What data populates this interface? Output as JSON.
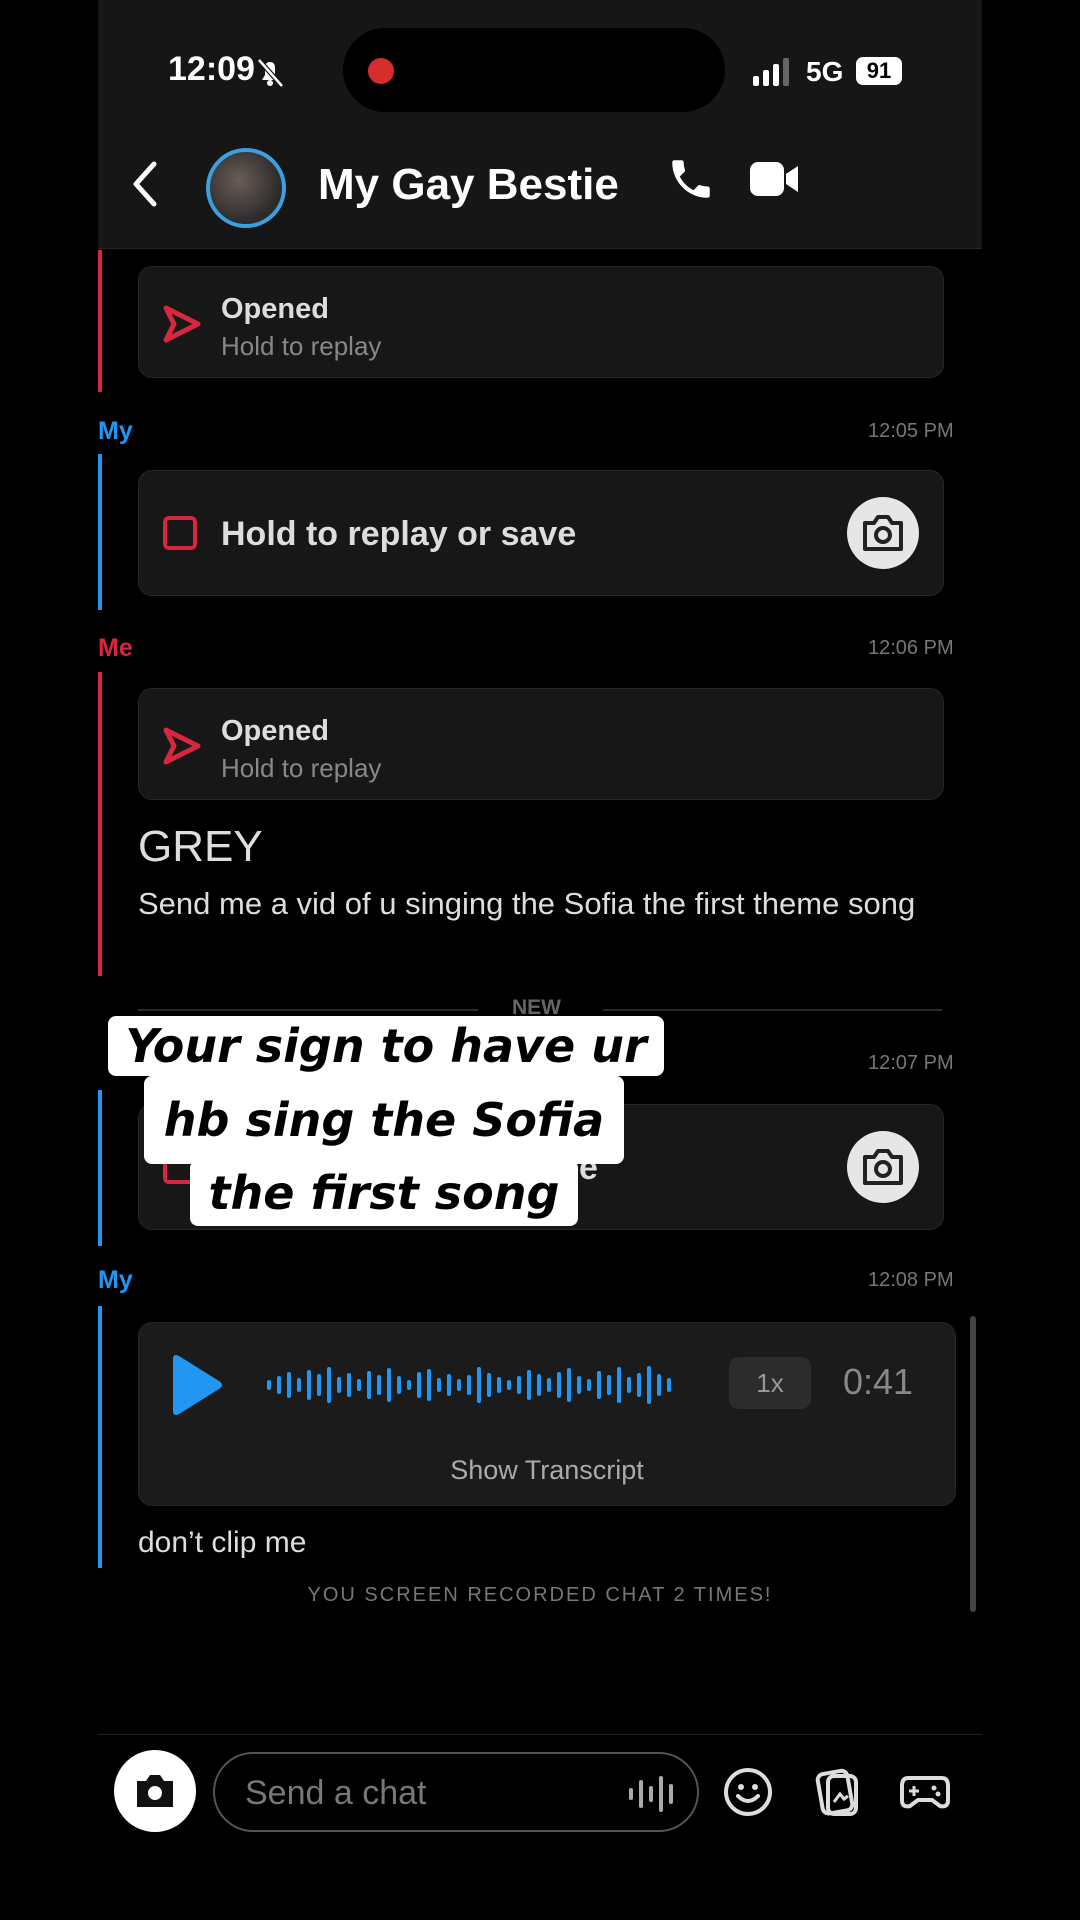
{
  "status_bar": {
    "time": "12:09",
    "network": "5G",
    "battery": "91"
  },
  "header": {
    "chat_name": "My Gay Bestie"
  },
  "messages": {
    "opened1": {
      "label": "Opened",
      "sub": "Hold to replay"
    },
    "my1": {
      "sender": "My",
      "time": "12:05 PM",
      "text": "Hold to replay or save"
    },
    "me1": {
      "sender": "Me",
      "time": "12:06 PM"
    },
    "opened2": {
      "label": "Opened",
      "sub": "Hold to replay"
    },
    "grey": "GREY",
    "msg_text": "Send me a vid of u singing the Sofia the first theme song",
    "new_label": "NEW",
    "snap2": {
      "time": "12:07 PM",
      "text_tail": "e"
    },
    "my2": {
      "sender": "My",
      "time": "12:08 PM"
    },
    "voice": {
      "speed": "1x",
      "duration": "0:41",
      "transcript": "Show Transcript"
    },
    "clip_text": "don’t clip me",
    "screen_record_notice": "YOU SCREEN RECORDED CHAT 2 TIMES!"
  },
  "overlay": {
    "line1": "Your sign to have ur",
    "line2": "hb sing the Sofia",
    "line3": "the first song"
  },
  "composer": {
    "placeholder": "Send a chat"
  },
  "colors": {
    "red": "#d7263d",
    "blue": "#2196f3",
    "background": "#000000"
  }
}
